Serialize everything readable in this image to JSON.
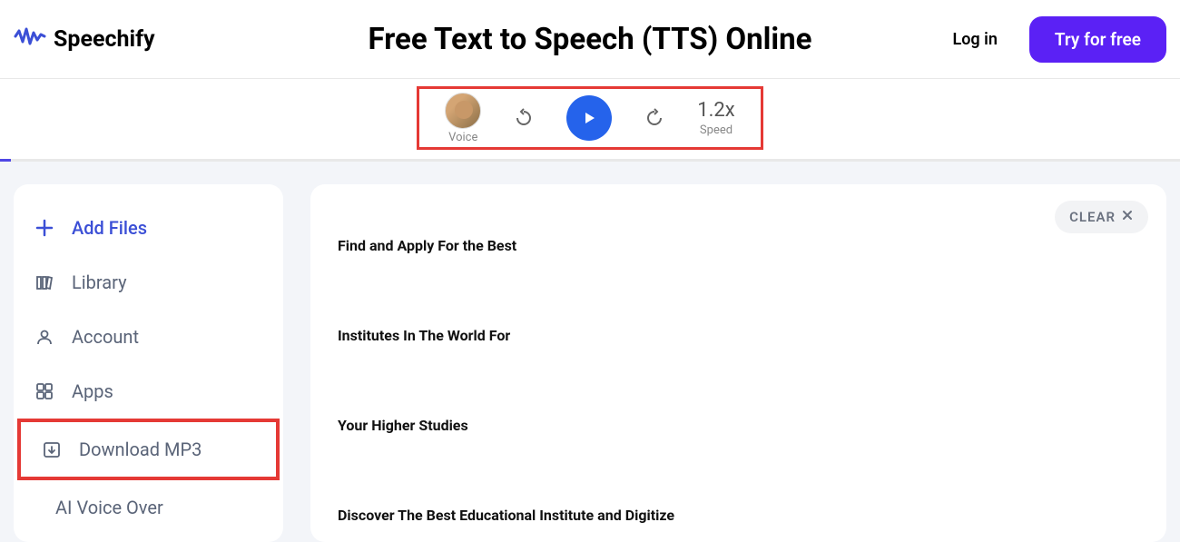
{
  "brand": "Speechify",
  "header": {
    "title": "Free Text to Speech (TTS) Online",
    "login_label": "Log in",
    "try_free_label": "Try for free"
  },
  "player": {
    "voice_label": "Voice",
    "speed_value": "1.2x",
    "speed_label": "Speed"
  },
  "sidebar": {
    "add_files": "Add Files",
    "library": "Library",
    "account": "Account",
    "apps": "Apps",
    "download_mp3": "Download MP3",
    "ai_voice_over": "AI Voice Over"
  },
  "main": {
    "clear_label": "CLEAR",
    "lines": [
      "Find and Apply For the Best",
      "Institutes In The World For",
      "Your Higher Studies",
      "Discover The Best Educational Institute and Digitize"
    ]
  }
}
